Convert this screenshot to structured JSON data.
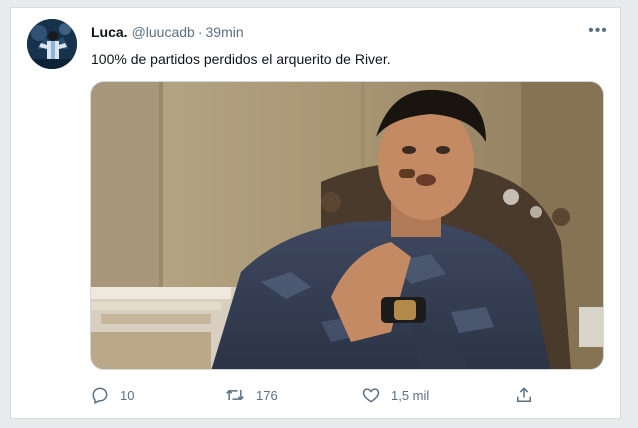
{
  "tweet": {
    "display_name": "Luca.",
    "handle": "@luucadb",
    "separator": "·",
    "time": "39min",
    "more_label": "•••",
    "text": "100% de partidos perdidos el arquerito de River."
  },
  "actions": {
    "reply_count": "10",
    "retweet_count": "176",
    "like_count": "1,5 mil"
  },
  "icons": {
    "reply": "reply-icon",
    "retweet": "retweet-icon",
    "like": "heart-icon",
    "share": "share-icon",
    "more": "more-icon"
  },
  "colors": {
    "secondary_text": "#5b7083",
    "primary_text": "#0f1419",
    "background": "#ffffff"
  }
}
